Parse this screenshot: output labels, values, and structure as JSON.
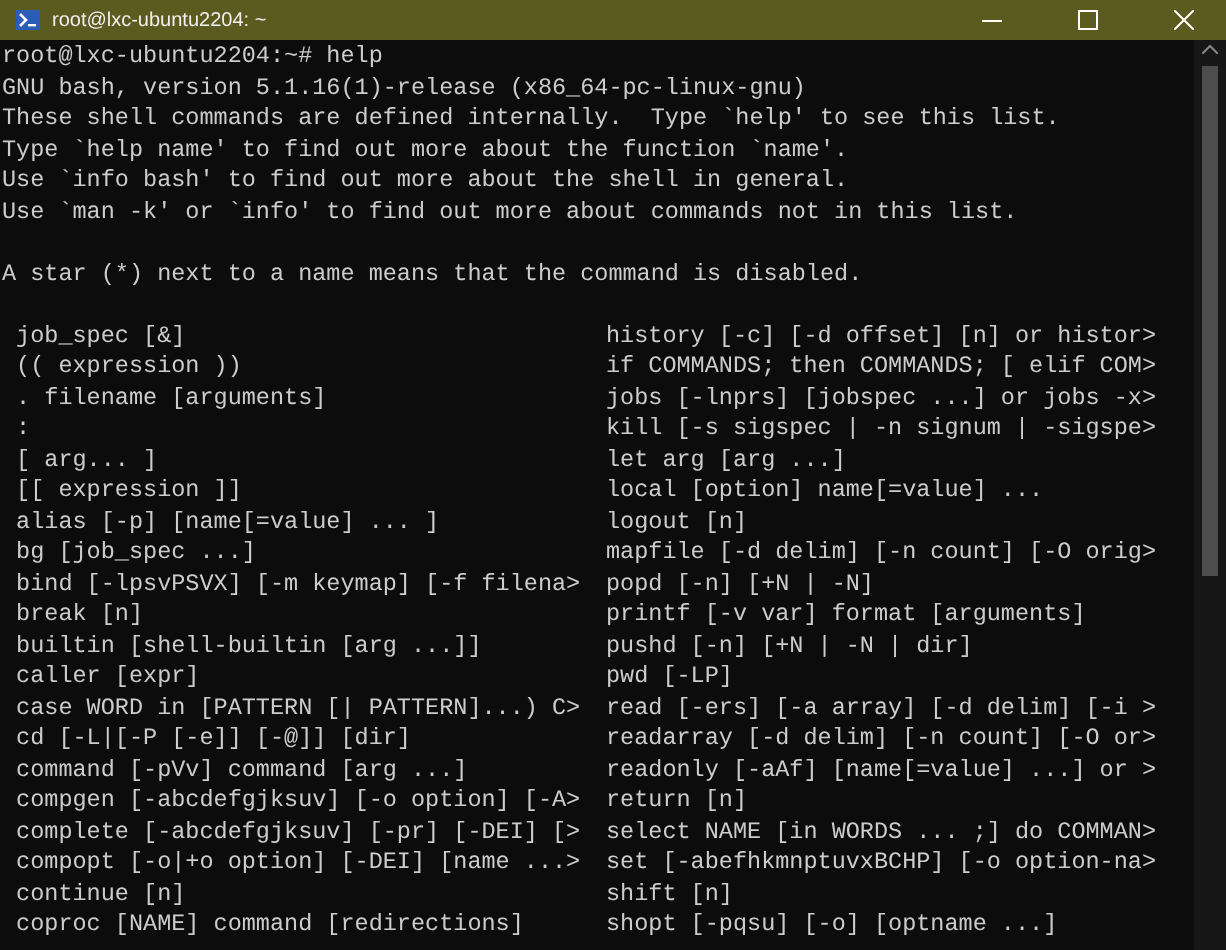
{
  "window": {
    "title": "root@lxc-ubuntu2204: ~"
  },
  "terminal": {
    "lines": [
      "root@lxc-ubuntu2204:~# help",
      "GNU bash, version 5.1.16(1)-release (x86_64-pc-linux-gnu)",
      "These shell commands are defined internally.  Type `help' to see this list.",
      "Type `help name' to find out more about the function `name'.",
      "Use `info bash' to find out more about the shell in general.",
      "Use `man -k' or `info' to find out more about commands not in this list."
    ],
    "note": "A star (*) next to a name means that the command is disabled.",
    "commands": [
      {
        "left": "job_spec [&]",
        "right": "history [-c] [-d offset] [n] or histor>"
      },
      {
        "left": "(( expression ))",
        "right": "if COMMANDS; then COMMANDS; [ elif COM>"
      },
      {
        "left": ". filename [arguments]",
        "right": "jobs [-lnprs] [jobspec ...] or jobs -x>"
      },
      {
        "left": ":",
        "right": "kill [-s sigspec | -n signum | -sigspe>"
      },
      {
        "left": "[ arg... ]",
        "right": "let arg [arg ...]"
      },
      {
        "left": "[[ expression ]]",
        "right": "local [option] name[=value] ..."
      },
      {
        "left": "alias [-p] [name[=value] ... ]",
        "right": "logout [n]"
      },
      {
        "left": "bg [job_spec ...]",
        "right": "mapfile [-d delim] [-n count] [-O orig>"
      },
      {
        "left": "bind [-lpsvPSVX] [-m keymap] [-f filena>",
        "right": "popd [-n] [+N | -N]"
      },
      {
        "left": "break [n]",
        "right": "printf [-v var] format [arguments]"
      },
      {
        "left": "builtin [shell-builtin [arg ...]]",
        "right": "pushd [-n] [+N | -N | dir]"
      },
      {
        "left": "caller [expr]",
        "right": "pwd [-LP]"
      },
      {
        "left": "case WORD in [PATTERN [| PATTERN]...) C>",
        "right": "read [-ers] [-a array] [-d delim] [-i >"
      },
      {
        "left": "cd [-L|[-P [-e]] [-@]] [dir]",
        "right": "readarray [-d delim] [-n count] [-O or>"
      },
      {
        "left": "command [-pVv] command [arg ...]",
        "right": "readonly [-aAf] [name[=value] ...] or >"
      },
      {
        "left": "compgen [-abcdefgjksuv] [-o option] [-A>",
        "right": "return [n]"
      },
      {
        "left": "complete [-abcdefgjksuv] [-pr] [-DEI] [>",
        "right": "select NAME [in WORDS ... ;] do COMMAN>"
      },
      {
        "left": "compopt [-o|+o option] [-DEI] [name ...>",
        "right": "set [-abefhkmnptuvxBCHP] [-o option-na>"
      },
      {
        "left": "continue [n]",
        "right": "shift [n]"
      },
      {
        "left": "coproc [NAME] command [redirections]",
        "right": "shopt [-pqsu] [-o] [optname ...]"
      }
    ]
  }
}
